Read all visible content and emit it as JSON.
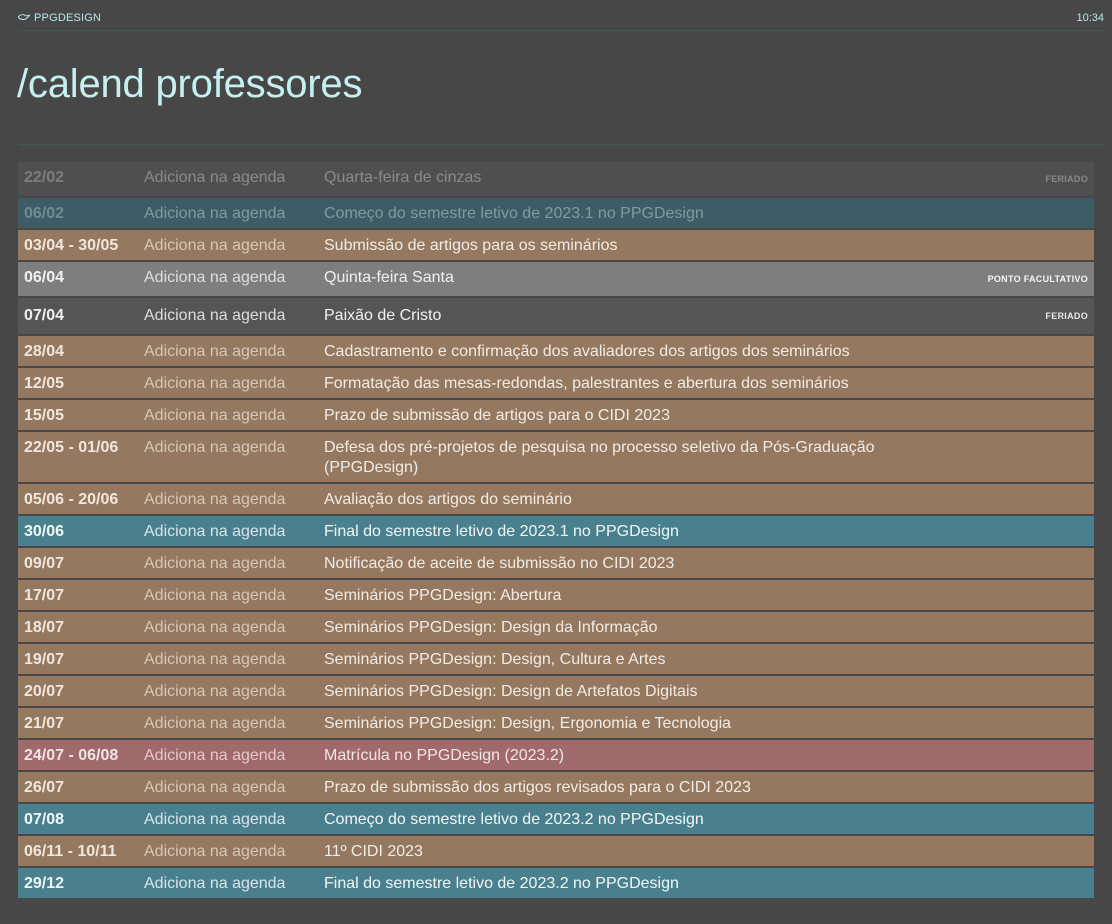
{
  "header": {
    "brand": "PPGDESIGN",
    "time": "10:34"
  },
  "page": {
    "title": "/calend professores"
  },
  "colors": {
    "background": "#474747",
    "accent_text": "#c6f0f0",
    "feriado": "#555555",
    "teal": "#4a7f8d",
    "brown": "#94785f",
    "grey": "#7e7e7e",
    "red": "#a0696b"
  },
  "events": [
    {
      "date": "22/02",
      "action": "Adiciona na agenda",
      "desc": "Quarta-feira de cinzas",
      "tag": "FERIADO",
      "variant": "v-feriado-dim"
    },
    {
      "date": "06/02",
      "action": "Adiciona na agenda",
      "desc": "Começo do semestre letivo de 2023.1 no PPGDesign",
      "tag": "",
      "variant": "v-teal-dim"
    },
    {
      "date": "03/04 - 30/05",
      "action": "Adiciona na agenda",
      "desc": "Submissão de artigos para os seminários",
      "tag": "",
      "variant": "v-brown"
    },
    {
      "date": "06/04",
      "action": "Adiciona na agenda",
      "desc": "Quinta-feira Santa",
      "tag": "PONTO FACULTATIVO",
      "variant": "v-grey"
    },
    {
      "date": "07/04",
      "action": "Adiciona na agenda",
      "desc": "Paixão de Cristo",
      "tag": "FERIADO",
      "variant": "v-feriado"
    },
    {
      "date": "28/04",
      "action": "Adiciona na agenda",
      "desc": "Cadastramento e confirmação dos avaliadores dos artigos dos seminários",
      "tag": "",
      "variant": "v-brown"
    },
    {
      "date": "12/05",
      "action": "Adiciona na agenda",
      "desc": "Formatação das mesas-redondas, palestrantes e abertura dos seminários",
      "tag": "",
      "variant": "v-brown"
    },
    {
      "date": "15/05",
      "action": "Adiciona na agenda",
      "desc": "Prazo de submissão de artigos para o CIDI 2023",
      "tag": "",
      "variant": "v-brown"
    },
    {
      "date": "22/05 - 01/06",
      "action": "Adiciona na agenda",
      "desc": "Defesa dos pré-projetos de pesquisa no processo seletivo da Pós-Graduação (PPGDesign)",
      "tag": "",
      "variant": "v-brown"
    },
    {
      "date": "05/06 - 20/06",
      "action": "Adiciona na agenda",
      "desc": "Avaliação dos artigos do seminário",
      "tag": "",
      "variant": "v-brown"
    },
    {
      "date": "30/06",
      "action": "Adiciona na agenda",
      "desc": "Final do semestre letivo de 2023.1 no PPGDesign",
      "tag": "",
      "variant": "v-teal"
    },
    {
      "date": "09/07",
      "action": "Adiciona na agenda",
      "desc": "Notificação de aceite de submissão no CIDI 2023",
      "tag": "",
      "variant": "v-brown"
    },
    {
      "date": "17/07",
      "action": "Adiciona na agenda",
      "desc": "Seminários PPGDesign: Abertura",
      "tag": "",
      "variant": "v-brown"
    },
    {
      "date": "18/07",
      "action": "Adiciona na agenda",
      "desc": "Seminários PPGDesign: Design da Informação",
      "tag": "",
      "variant": "v-brown"
    },
    {
      "date": "19/07",
      "action": "Adiciona na agenda",
      "desc": "Seminários PPGDesign: Design, Cultura e Artes",
      "tag": "",
      "variant": "v-brown"
    },
    {
      "date": "20/07",
      "action": "Adiciona na agenda",
      "desc": "Seminários PPGDesign: Design de Artefatos Digitais",
      "tag": "",
      "variant": "v-brown"
    },
    {
      "date": "21/07",
      "action": "Adiciona na agenda",
      "desc": "Seminários PPGDesign: Design, Ergonomia e Tecnologia",
      "tag": "",
      "variant": "v-brown"
    },
    {
      "date": "24/07 - 06/08",
      "action": "Adiciona na agenda",
      "desc": "Matrícula no PPGDesign (2023.2)",
      "tag": "",
      "variant": "v-red"
    },
    {
      "date": "26/07",
      "action": "Adiciona na agenda",
      "desc": "Prazo de submissão dos artigos revisados para o CIDI 2023",
      "tag": "",
      "variant": "v-brown"
    },
    {
      "date": "07/08",
      "action": "Adiciona na agenda",
      "desc": "Começo do semestre letivo de 2023.2 no PPGDesign",
      "tag": "",
      "variant": "v-teal"
    },
    {
      "date": "06/11 - 10/11",
      "action": "Adiciona na agenda",
      "desc": "11º CIDI 2023",
      "tag": "",
      "variant": "v-brown"
    },
    {
      "date": "29/12",
      "action": "Adiciona na agenda",
      "desc": "Final do semestre letivo de 2023.2 no PPGDesign",
      "tag": "",
      "variant": "v-teal"
    }
  ]
}
